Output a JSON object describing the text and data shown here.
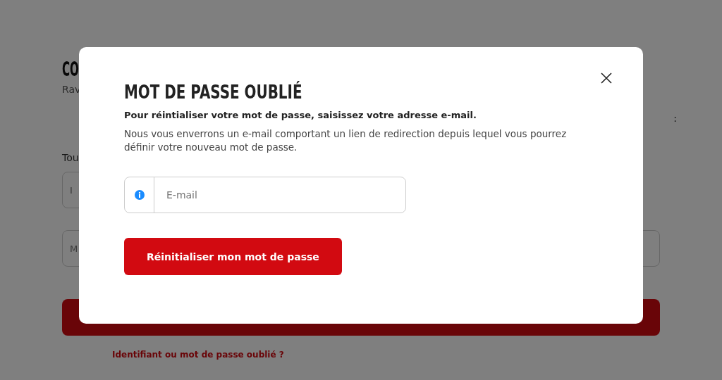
{
  "page": {
    "title": "CO",
    "subtitle": "Rav",
    "side_text": ":",
    "intro": "Tou",
    "fields": [
      {
        "placeholder": "I"
      },
      {
        "placeholder": "M"
      }
    ],
    "forgot_link": "Identifiant ou mot de passe oublié ?"
  },
  "modal": {
    "title": "MOT DE PASSE OUBLIÉ",
    "lead": "Pour réintialiser votre mot de passe, saisissez votre adresse e-mail.",
    "description": "Nous vous enverrons un e-mail comportant un lien de redirection depuis lequel vous pourrez définir votre nouveau mot de passe.",
    "email": {
      "placeholder": "E-mail"
    },
    "submit": "Réinitialiser mon mot de passe"
  }
}
